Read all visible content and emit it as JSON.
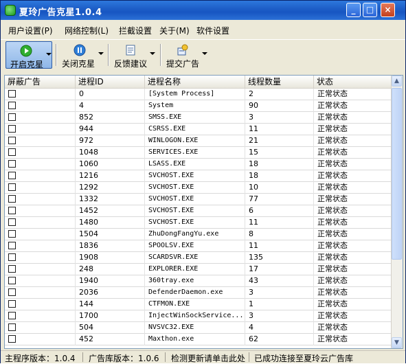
{
  "window": {
    "title": "夏玲广告克星1.0.4"
  },
  "menu": [
    "用户设置(P)",
    "网络控制(L)",
    "拦截设置",
    "关于(M)",
    "软件设置"
  ],
  "toolbar": {
    "start": "开启克星",
    "close": "关闭克星",
    "feedback": "反馈建议",
    "submit": "提交广告"
  },
  "columns": [
    "屏蔽广告",
    "进程ID",
    "进程名称",
    "线程数量",
    "状态"
  ],
  "rows": [
    {
      "pid": "0",
      "name": "[System Process]",
      "threads": "2",
      "status": "正常状态"
    },
    {
      "pid": "4",
      "name": "System",
      "threads": "90",
      "status": "正常状态"
    },
    {
      "pid": "852",
      "name": "SMSS.EXE",
      "threads": "3",
      "status": "正常状态"
    },
    {
      "pid": "944",
      "name": "CSRSS.EXE",
      "threads": "11",
      "status": "正常状态"
    },
    {
      "pid": "972",
      "name": "WINLOGON.EXE",
      "threads": "21",
      "status": "正常状态"
    },
    {
      "pid": "1048",
      "name": "SERVICES.EXE",
      "threads": "15",
      "status": "正常状态"
    },
    {
      "pid": "1060",
      "name": "LSASS.EXE",
      "threads": "18",
      "status": "正常状态"
    },
    {
      "pid": "1216",
      "name": "SVCHOST.EXE",
      "threads": "18",
      "status": "正常状态"
    },
    {
      "pid": "1292",
      "name": "SVCHOST.EXE",
      "threads": "10",
      "status": "正常状态"
    },
    {
      "pid": "1332",
      "name": "SVCHOST.EXE",
      "threads": "77",
      "status": "正常状态"
    },
    {
      "pid": "1452",
      "name": "SVCHOST.EXE",
      "threads": "6",
      "status": "正常状态"
    },
    {
      "pid": "1480",
      "name": "SVCHOST.EXE",
      "threads": "11",
      "status": "正常状态"
    },
    {
      "pid": "1504",
      "name": "ZhuDongFangYu.exe",
      "threads": "8",
      "status": "正常状态"
    },
    {
      "pid": "1836",
      "name": "SPOOLSV.EXE",
      "threads": "11",
      "status": "正常状态"
    },
    {
      "pid": "1908",
      "name": "SCARDSVR.EXE",
      "threads": "135",
      "status": "正常状态"
    },
    {
      "pid": "248",
      "name": "EXPLORER.EXE",
      "threads": "17",
      "status": "正常状态"
    },
    {
      "pid": "1940",
      "name": "360tray.exe",
      "threads": "43",
      "status": "正常状态"
    },
    {
      "pid": "2036",
      "name": "DefenderDaemon.exe",
      "threads": "3",
      "status": "正常状态"
    },
    {
      "pid": "144",
      "name": "CTFMON.EXE",
      "threads": "1",
      "status": "正常状态"
    },
    {
      "pid": "1700",
      "name": "InjectWinSockService...",
      "threads": "3",
      "status": "正常状态"
    },
    {
      "pid": "504",
      "name": "NVSVC32.EXE",
      "threads": "4",
      "status": "正常状态"
    },
    {
      "pid": "452",
      "name": "Maxthon.exe",
      "threads": "62",
      "status": "正常状态"
    }
  ],
  "status": {
    "main_version": "主程序版本：1.0.4",
    "ad_version": "广告库版本：1.0.6",
    "update": "检测更新请单击此处",
    "connected": "已成功连接至夏玲云广告库"
  },
  "colors": {
    "titlebar": "#1e5fc8",
    "toolbar_active": "#8fb7e8"
  }
}
